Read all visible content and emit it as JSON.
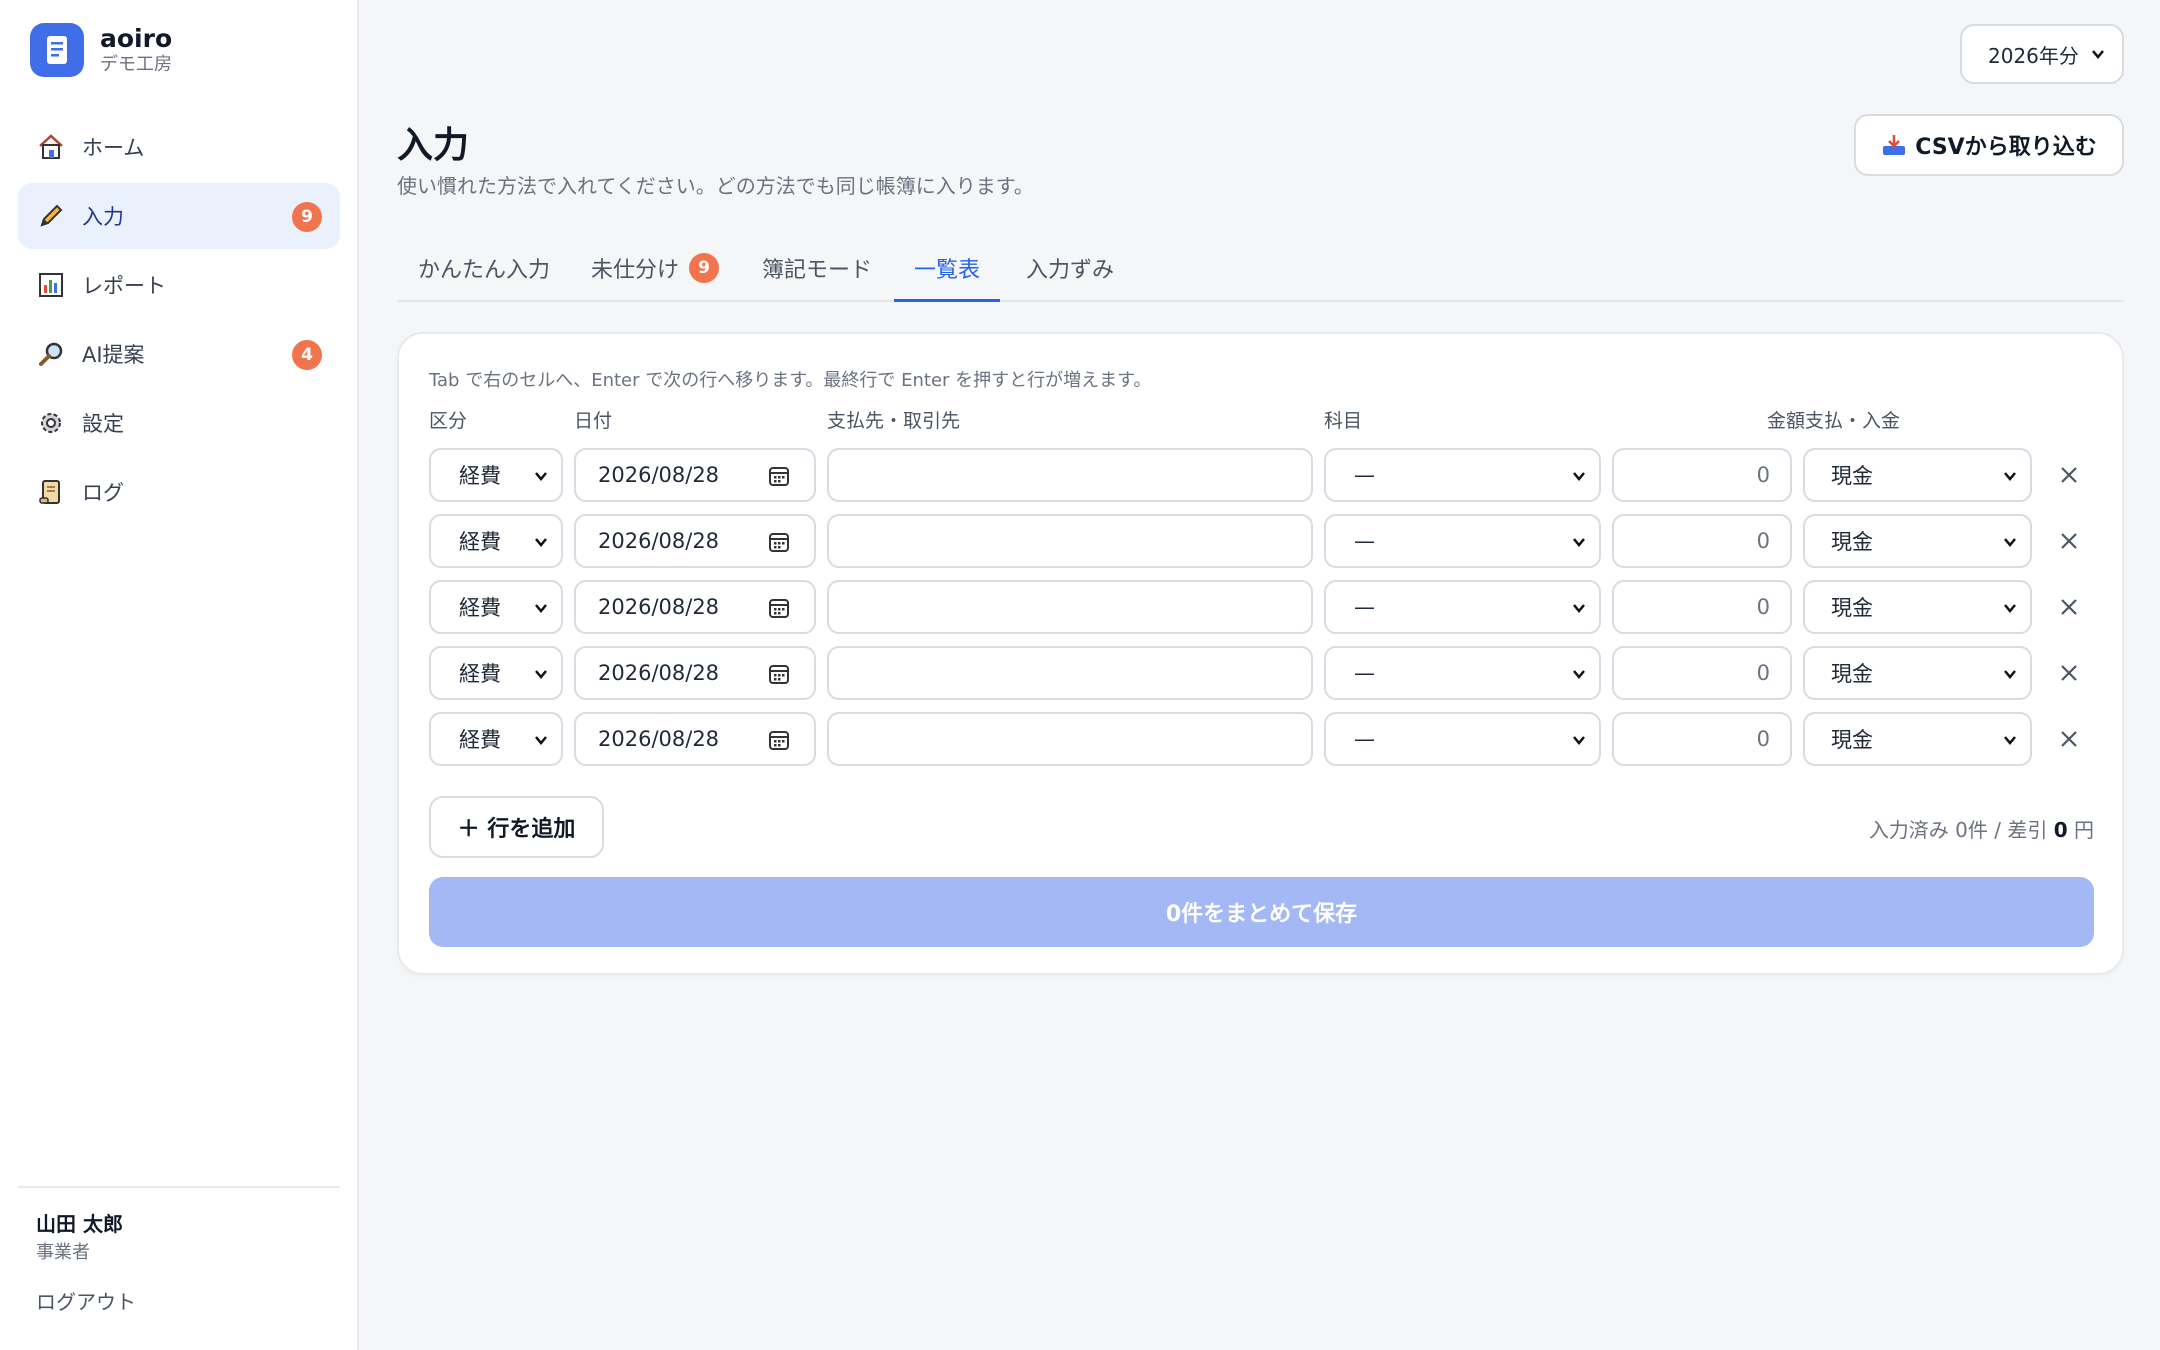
{
  "app": {
    "name": "aoiro",
    "org": "デモ工房"
  },
  "sidebar": {
    "items": [
      {
        "label": "ホーム",
        "icon": "home-icon"
      },
      {
        "label": "入力",
        "icon": "pencil-icon",
        "badge": "9",
        "active": true
      },
      {
        "label": "レポート",
        "icon": "bar-chart-icon"
      },
      {
        "label": "AI提案",
        "icon": "magnifier-icon",
        "badge": "4"
      },
      {
        "label": "設定",
        "icon": "gear-icon"
      },
      {
        "label": "ログ",
        "icon": "scroll-icon"
      }
    ],
    "user": {
      "name": "山田 太郎",
      "role": "事業者"
    },
    "logout": "ログアウト"
  },
  "header": {
    "year": "2026年分",
    "title": "入力",
    "subtitle": "使い慣れた方法で入れてください。どの方法でも同じ帳簿に入ります。",
    "csv_button": "CSVから取り込む"
  },
  "tabs": [
    {
      "label": "かんたん入力"
    },
    {
      "label": "未仕分け",
      "badge": "9"
    },
    {
      "label": "簿記モード"
    },
    {
      "label": "一覧表",
      "active": true
    },
    {
      "label": "入力ずみ"
    }
  ],
  "grid": {
    "hint": "Tab で右のセルへ、Enter で次の行へ移ります。最終行で Enter を押すと行が増えます。",
    "headers": {
      "kubun": "区分",
      "date": "日付",
      "payee": "支払先・取引先",
      "subject": "科目",
      "amount_method": "金額支払・入金"
    },
    "rows": [
      {
        "kubun": "経費",
        "date": "2026/08/28",
        "payee": "",
        "subject": "—",
        "amount": "0",
        "method": "現金"
      },
      {
        "kubun": "経費",
        "date": "2026/08/28",
        "payee": "",
        "subject": "—",
        "amount": "0",
        "method": "現金"
      },
      {
        "kubun": "経費",
        "date": "2026/08/28",
        "payee": "",
        "subject": "—",
        "amount": "0",
        "method": "現金"
      },
      {
        "kubun": "経費",
        "date": "2026/08/28",
        "payee": "",
        "subject": "—",
        "amount": "0",
        "method": "現金"
      },
      {
        "kubun": "経費",
        "date": "2026/08/28",
        "payee": "",
        "subject": "—",
        "amount": "0",
        "method": "現金"
      }
    ],
    "add_row": "＋ 行を追加",
    "summary_prefix": "入力済み 0件 / 差引 ",
    "summary_amount": "0",
    "summary_unit": " 円",
    "save_all": "0件をまとめて保存"
  },
  "colors": {
    "accent": "#2563eb",
    "brand": "#3f6ee8",
    "badge": "#f0754f",
    "save_disabled": "#a4b8f5"
  }
}
